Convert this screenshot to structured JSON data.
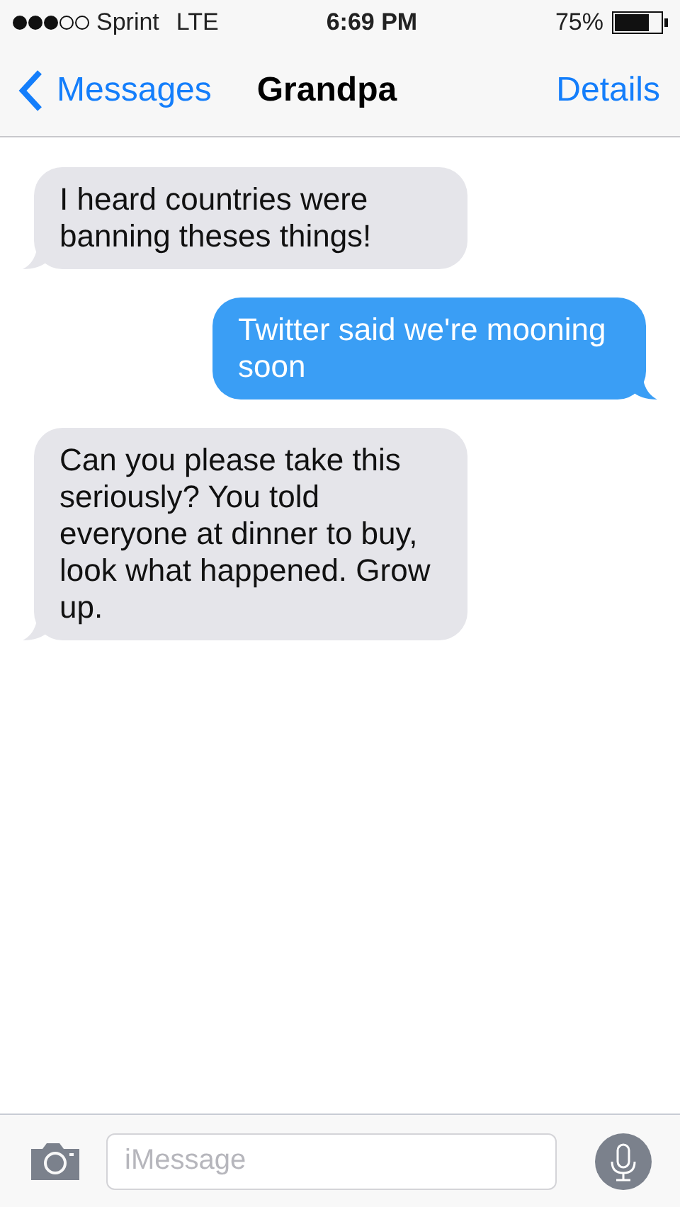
{
  "status_bar": {
    "carrier": "Sprint",
    "network": "LTE",
    "time": "6:69 PM",
    "battery": "75%"
  },
  "nav": {
    "back": "Messages",
    "title": "Grandpa",
    "action": "Details"
  },
  "messages": [
    {
      "kind": "received",
      "text": "I heard countries were banning theses things!"
    },
    {
      "kind": "sent",
      "text": "Twitter said we're mooning soon"
    },
    {
      "kind": "received",
      "text": "Can you please take this seriously? You told everyone at dinner to buy, look what happened. Grow up."
    }
  ],
  "composer": {
    "placeholder": "iMessage"
  }
}
